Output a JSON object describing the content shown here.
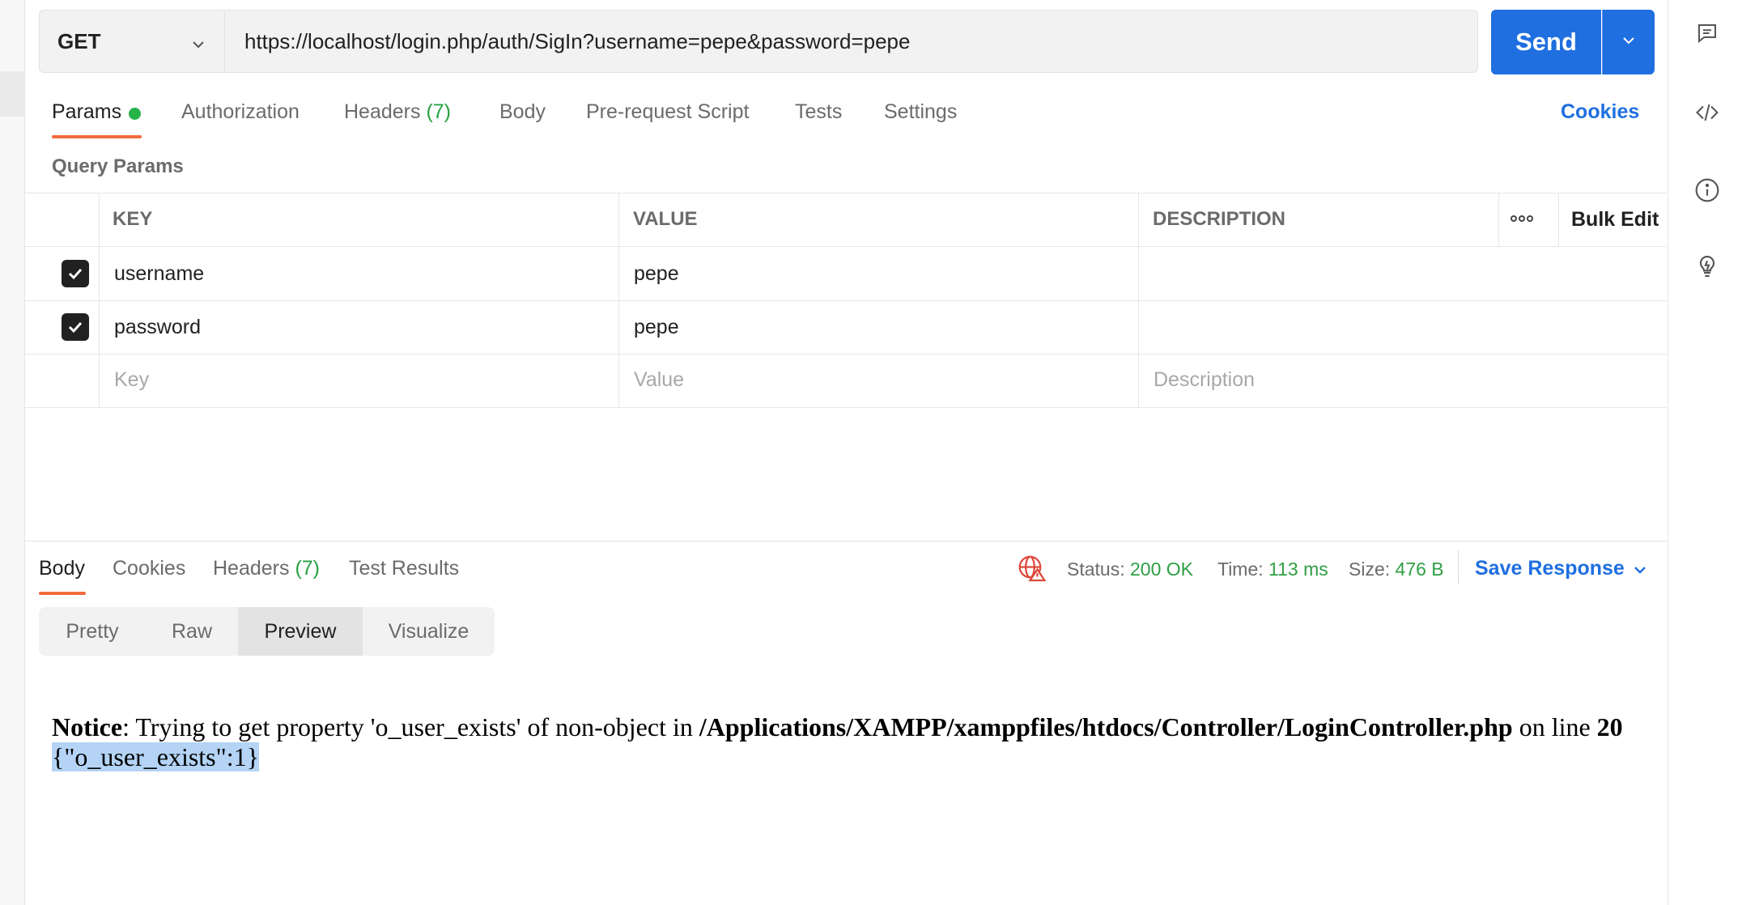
{
  "request": {
    "method": "GET",
    "url": "https://localhost/login.php/auth/SigIn?username=pepe&password=pepe",
    "send_label": "Send"
  },
  "request_tabs": {
    "params": "Params",
    "authorization": "Authorization",
    "headers": "Headers",
    "headers_count": "(7)",
    "body": "Body",
    "prerequest": "Pre-request Script",
    "tests": "Tests",
    "settings": "Settings",
    "cookies": "Cookies"
  },
  "query_params": {
    "title": "Query Params",
    "columns": {
      "key": "KEY",
      "value": "VALUE",
      "description": "DESCRIPTION"
    },
    "bulk_edit": "Bulk Edit",
    "rows": [
      {
        "checked": true,
        "key": "username",
        "value": "pepe",
        "description": ""
      },
      {
        "checked": true,
        "key": "password",
        "value": "pepe",
        "description": ""
      }
    ],
    "placeholders": {
      "key": "Key",
      "value": "Value",
      "description": "Description"
    }
  },
  "response_tabs": {
    "body": "Body",
    "cookies": "Cookies",
    "headers": "Headers",
    "headers_count": "(7)",
    "test_results": "Test Results"
  },
  "response_status": {
    "status_label": "Status:",
    "status_value": "200 OK",
    "time_label": "Time:",
    "time_value": "113 ms",
    "size_label": "Size:",
    "size_value": "476 B",
    "save_response": "Save Response"
  },
  "view_modes": {
    "pretty": "Pretty",
    "raw": "Raw",
    "preview": "Preview",
    "visualize": "Visualize",
    "selected": "Preview"
  },
  "preview": {
    "notice_label": "Notice",
    "notice_text": ": Trying to get property 'o_user_exists' of non-object in ",
    "path": "/Applications/XAMPP/xamppfiles/htdocs/Controller/LoginController.php",
    "on_line": " on line ",
    "line_number": "20",
    "json_output": "{\"o_user_exists\":1}"
  },
  "icons": {
    "right_sidebar": [
      "comments-icon",
      "code-icon",
      "info-icon",
      "lightbulb-icon"
    ],
    "status": "globe-warning-icon"
  },
  "colors": {
    "primary": "#1f6fe0",
    "tab_underline": "#f26b3a",
    "success": "#2f9e44",
    "selection": "#b4d3f5"
  }
}
